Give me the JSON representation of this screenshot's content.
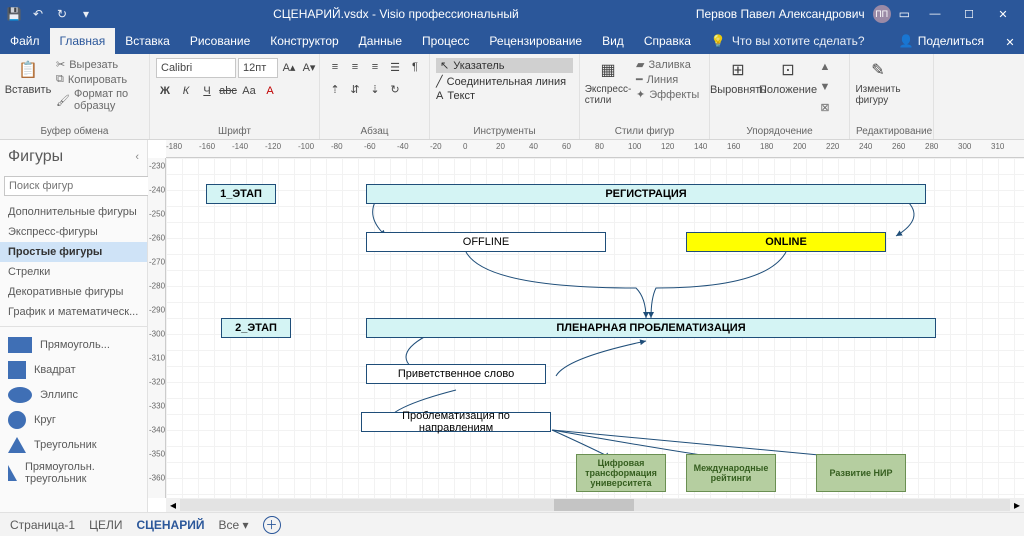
{
  "titlebar": {
    "filename": "СЦЕНАРИЙ.vsdx",
    "appname": "Visio профессиональный",
    "user": "Первов Павел Александрович",
    "userInitials": "ПП"
  },
  "tabs": [
    "Файл",
    "Главная",
    "Вставка",
    "Рисование",
    "Конструктор",
    "Данные",
    "Процесс",
    "Рецензирование",
    "Вид",
    "Справка"
  ],
  "activeTabIndex": 1,
  "tellme": "Что вы хотите сделать?",
  "share": "Поделиться",
  "ribbon": {
    "paste": "Вставить",
    "cut": "Вырезать",
    "copy": "Копировать",
    "formatPainter": "Формат по образцу",
    "clipboard": "Буфер обмена",
    "fontName": "Calibri",
    "fontSize": "12пт",
    "fontGroup": "Шрифт",
    "paraGroup": "Абзац",
    "pointer": "Указатель",
    "connector": "Соединительная линия",
    "text": "Текст",
    "tools": "Инструменты",
    "express": "Экспресс-стили",
    "fill": "Заливка",
    "line": "Линия",
    "effects": "Эффекты",
    "shapeStyles": "Стили фигур",
    "align": "Выровнять",
    "position": "Положение",
    "arrange": "Упорядочение",
    "changeShape": "Изменить фигуру",
    "editing": "Редактирование"
  },
  "stencil": {
    "header": "Фигуры",
    "searchPlaceholder": "Поиск фигур",
    "categories": [
      "Дополнительные фигуры",
      "Экспресс-фигуры",
      "Простые фигуры",
      "Стрелки",
      "Декоративные фигуры",
      "График и математическ..."
    ],
    "activeCategoryIndex": 2,
    "shapes": [
      "Прямоуголь...",
      "Квадрат",
      "Эллипс",
      "Круг",
      "Треугольник",
      "Прямоугольн. треугольник"
    ]
  },
  "diagram": {
    "stage1": "1_ЭТАП",
    "stage2": "2_ЭТАП",
    "registration": "РЕГИСТРАЦИЯ",
    "offline": "OFFLINE",
    "online": "ONLINE",
    "plenary": "ПЛЕНАРНАЯ ПРОБЛЕМАТИЗАЦИЯ",
    "welcome": "Приветственное слово",
    "problem": "Проблематизация по направлениям",
    "dir1": "Цифровая трансформация университета",
    "dir2": "Международные рейтинги",
    "dir3": "Развитие НИР"
  },
  "footer": {
    "page1": "Страница-1",
    "page2": "ЦЕЛИ",
    "page3": "СЦЕНАРИЙ",
    "all": "Все"
  },
  "hrulerTicks": [
    -180,
    -160,
    -140,
    -120,
    -100,
    -80,
    -60,
    -40,
    -20,
    0,
    20,
    40,
    60,
    80,
    100,
    120,
    140,
    160,
    180,
    200,
    220,
    240,
    260,
    280,
    300,
    310
  ],
  "vrulerTicks": [
    -230,
    -240,
    -250,
    -260,
    -270,
    -280,
    -290,
    -300,
    -310,
    -320,
    -330,
    -340,
    -350,
    -360
  ]
}
